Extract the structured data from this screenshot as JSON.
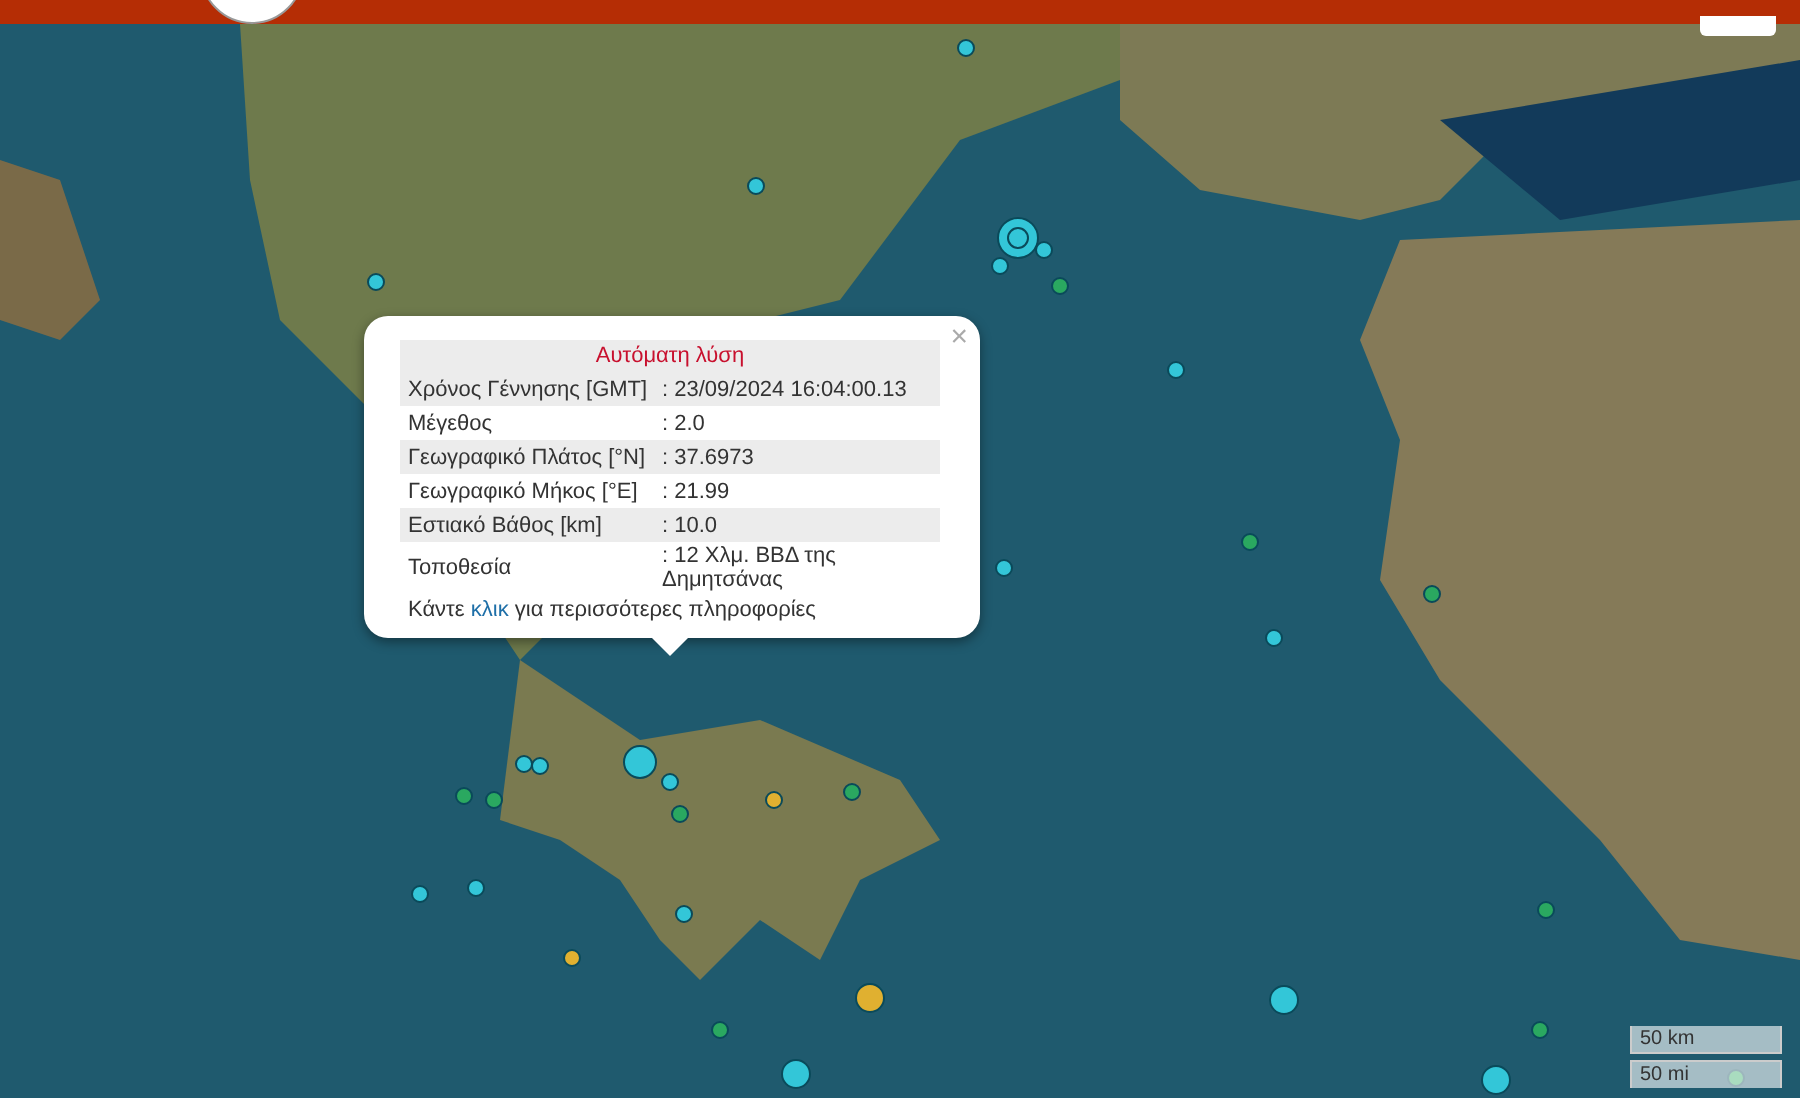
{
  "popup": {
    "close": "×",
    "title": "Αυτόματη λύση",
    "rows": [
      {
        "label": "Χρόνος Γέννησης [GMT]",
        "value": ": 23/09/2024 16:04:00.13"
      },
      {
        "label": "Μέγεθος",
        "value": ": 2.0"
      },
      {
        "label": "Γεωγραφικό Πλάτος [°N]",
        "value": ": 37.6973"
      },
      {
        "label": "Γεωγραφικό Μήκος [°E]",
        "value": ": 21.99"
      },
      {
        "label": "Εστιακό Βάθος [km]",
        "value": ": 10.0"
      },
      {
        "label": "Τοποθεσία",
        "value": ": 12 Χλμ. ΒΒΔ της Δημητσάνας"
      }
    ],
    "more_info": {
      "before": "Κάντε ",
      "link": "κλικ",
      "after": " για περισσότερες πληροφορίες"
    }
  },
  "scale": [
    "50 km",
    "50 mi"
  ]
}
